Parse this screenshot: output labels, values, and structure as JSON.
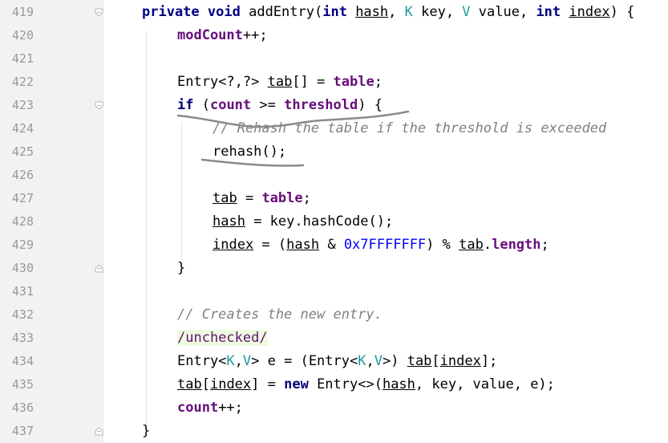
{
  "editor": {
    "lines": [
      {
        "num": "419",
        "indent": 0,
        "fold": "start",
        "tokens": [
          [
            "kw",
            "private"
          ],
          [
            "",
            " "
          ],
          [
            "kw",
            "void"
          ],
          [
            "",
            " addEntry("
          ],
          [
            "kw",
            "int"
          ],
          [
            "",
            " "
          ],
          [
            "ul",
            "hash"
          ],
          [
            "",
            ", "
          ],
          [
            "tp",
            "K"
          ],
          [
            "",
            " key, "
          ],
          [
            "tp",
            "V"
          ],
          [
            "",
            " value, "
          ],
          [
            "kw",
            "int"
          ],
          [
            "",
            " "
          ],
          [
            "ul",
            "index"
          ],
          [
            "",
            ") {"
          ]
        ]
      },
      {
        "num": "420",
        "indent": 1,
        "fold": "",
        "tokens": [
          [
            "fld",
            "modCount"
          ],
          [
            "",
            "++;"
          ]
        ]
      },
      {
        "num": "421",
        "indent": 0,
        "fold": "",
        "tokens": []
      },
      {
        "num": "422",
        "indent": 1,
        "fold": "",
        "tokens": [
          [
            "",
            "Entry<?,?> "
          ],
          [
            "ul",
            "tab"
          ],
          [
            "",
            "[] = "
          ],
          [
            "fld",
            "table"
          ],
          [
            "",
            ";"
          ]
        ]
      },
      {
        "num": "423",
        "indent": 1,
        "fold": "start",
        "tokens": [
          [
            "kw",
            "if"
          ],
          [
            "",
            " ("
          ],
          [
            "fld",
            "count"
          ],
          [
            "",
            " >= "
          ],
          [
            "fld",
            "threshold"
          ],
          [
            "",
            ") {"
          ]
        ]
      },
      {
        "num": "424",
        "indent": 2,
        "fold": "",
        "tokens": [
          [
            "cmt",
            "// Rehash the table if the threshold is exceeded"
          ]
        ]
      },
      {
        "num": "425",
        "indent": 2,
        "fold": "",
        "tokens": [
          [
            "",
            "rehash();"
          ]
        ]
      },
      {
        "num": "426",
        "indent": 0,
        "fold": "",
        "tokens": []
      },
      {
        "num": "427",
        "indent": 2,
        "fold": "",
        "tokens": [
          [
            "ul",
            "tab"
          ],
          [
            "",
            " = "
          ],
          [
            "fld",
            "table"
          ],
          [
            "",
            ";"
          ]
        ]
      },
      {
        "num": "428",
        "indent": 2,
        "fold": "",
        "tokens": [
          [
            "ul",
            "hash"
          ],
          [
            "",
            " = key.hashCode();"
          ]
        ]
      },
      {
        "num": "429",
        "indent": 2,
        "fold": "",
        "tokens": [
          [
            "ul",
            "index"
          ],
          [
            "",
            " = ("
          ],
          [
            "ul",
            "hash"
          ],
          [
            "",
            " & "
          ],
          [
            "num",
            "0x7FFFFFFF"
          ],
          [
            "",
            ") % "
          ],
          [
            "ul",
            "tab"
          ],
          [
            "",
            "."
          ],
          [
            "fld",
            "length"
          ],
          [
            "",
            ";"
          ]
        ]
      },
      {
        "num": "430",
        "indent": 1,
        "fold": "end",
        "tokens": [
          [
            "",
            "}"
          ]
        ]
      },
      {
        "num": "431",
        "indent": 0,
        "fold": "",
        "tokens": []
      },
      {
        "num": "432",
        "indent": 1,
        "fold": "",
        "tokens": [
          [
            "cmt",
            "// Creates the new entry."
          ]
        ]
      },
      {
        "num": "433",
        "indent": 1,
        "fold": "",
        "tokens": [
          [
            "hl",
            "/unchecked/"
          ]
        ]
      },
      {
        "num": "434",
        "indent": 1,
        "fold": "",
        "tokens": [
          [
            "",
            "Entry<"
          ],
          [
            "tp",
            "K"
          ],
          [
            "",
            ","
          ],
          [
            "tp",
            "V"
          ],
          [
            "",
            "> e = (Entry<"
          ],
          [
            "tp",
            "K"
          ],
          [
            "",
            ","
          ],
          [
            "tp",
            "V"
          ],
          [
            "",
            ">) "
          ],
          [
            "ul",
            "tab"
          ],
          [
            "",
            "["
          ],
          [
            "ul",
            "index"
          ],
          [
            "",
            "];"
          ]
        ]
      },
      {
        "num": "435",
        "indent": 1,
        "fold": "",
        "tokens": [
          [
            "ul",
            "tab"
          ],
          [
            "",
            "["
          ],
          [
            "ul",
            "index"
          ],
          [
            "",
            "] = "
          ],
          [
            "kw",
            "new"
          ],
          [
            "",
            " Entry<>("
          ],
          [
            "ul",
            "hash"
          ],
          [
            "",
            ", key, value, e);"
          ]
        ]
      },
      {
        "num": "436",
        "indent": 1,
        "fold": "",
        "tokens": [
          [
            "fld",
            "count"
          ],
          [
            "",
            "++;"
          ]
        ]
      },
      {
        "num": "437",
        "indent": 0,
        "fold": "end",
        "tokens": [
          [
            "",
            "}"
          ]
        ]
      }
    ]
  },
  "colors": {
    "keyword": "#000080",
    "field": "#660e7a",
    "type_param": "#20999d",
    "number": "#0000ff",
    "comment": "#808080",
    "annotation_highlight": "#edfcdf",
    "pen_scribble": "#8a8a8a"
  }
}
